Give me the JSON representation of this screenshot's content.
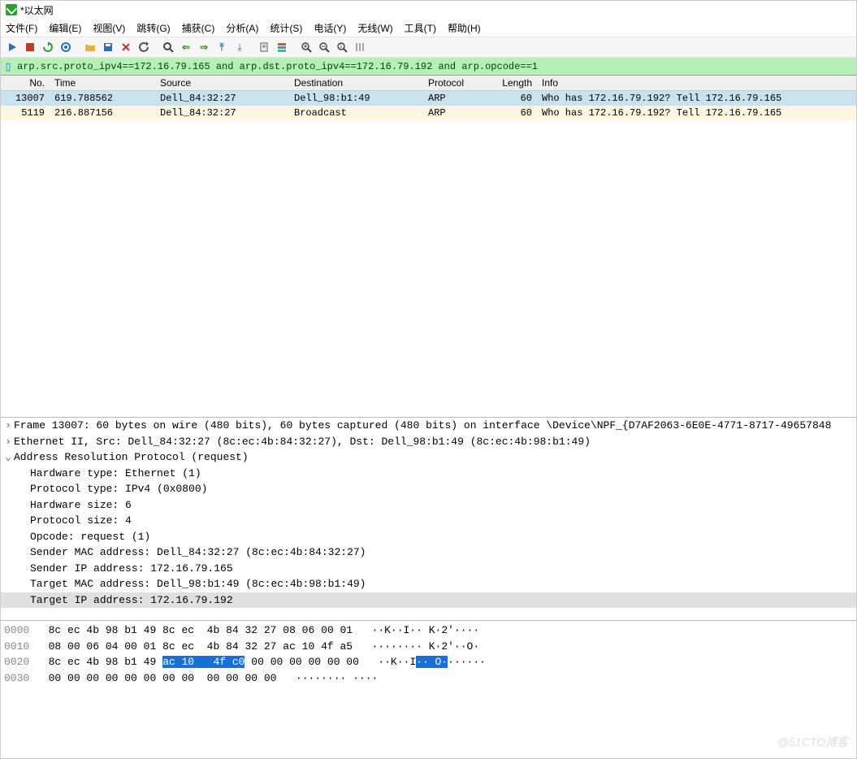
{
  "title": "*以太网",
  "menu": {
    "file": "文件(F)",
    "edit": "编辑(E)",
    "view": "视图(V)",
    "go": "跳转(G)",
    "capture": "捕获(C)",
    "analyze": "分析(A)",
    "stats": "统计(S)",
    "telephony": "电话(Y)",
    "wireless": "无线(W)",
    "tools": "工具(T)",
    "help": "帮助(H)"
  },
  "filter": "arp.src.proto_ipv4==172.16.79.165 and arp.dst.proto_ipv4==172.16.79.192 and arp.opcode==1",
  "columns": {
    "no": "No.",
    "time": "Time",
    "source": "Source",
    "destination": "Destination",
    "protocol": "Protocol",
    "length": "Length",
    "info": "Info"
  },
  "packets": [
    {
      "no": "13007",
      "time": "619.788562",
      "src": "Dell_84:32:27",
      "dst": "Dell_98:b1:49",
      "proto": "ARP",
      "len": "60",
      "info": "Who has 172.16.79.192? Tell 172.16.79.165",
      "selected": true
    },
    {
      "no": "5119",
      "time": "216.887156",
      "src": "Dell_84:32:27",
      "dst": "Broadcast",
      "proto": "ARP",
      "len": "60",
      "info": "Who has 172.16.79.192? Tell 172.16.79.165",
      "selected": false
    }
  ],
  "details": {
    "frame": "Frame 13007: 60 bytes on wire (480 bits), 60 bytes captured (480 bits) on interface \\Device\\NPF_{D7AF2063-6E0E-4771-8717-49657848",
    "eth": "Ethernet II, Src: Dell_84:32:27 (8c:ec:4b:84:32:27), Dst: Dell_98:b1:49 (8c:ec:4b:98:b1:49)",
    "arp": "Address Resolution Protocol (request)",
    "arp_fields": [
      "Hardware type: Ethernet (1)",
      "Protocol type: IPv4 (0x0800)",
      "Hardware size: 6",
      "Protocol size: 4",
      "Opcode: request (1)",
      "Sender MAC address: Dell_84:32:27 (8c:ec:4b:84:32:27)",
      "Sender IP address: 172.16.79.165",
      "Target MAC address: Dell_98:b1:49 (8c:ec:4b:98:b1:49)",
      "Target IP address: 172.16.79.192"
    ]
  },
  "hex": {
    "rows": [
      {
        "off": "0000",
        "b1": "8c ec 4b 98 b1 49 8c ec",
        "b2": "  4b 84 32 27 08 06 00 01",
        "a": "   ··K··I·· K·2'····"
      },
      {
        "off": "0010",
        "b1": "08 00 06 04 00 01 8c ec",
        "b2": "  4b 84 32 27 ac 10 4f a5",
        "a": "   ········ K·2'··O·"
      },
      {
        "off": "0020",
        "b1": "8c ec 4b 98 b1 49 ",
        "sel": "ac 10   4f c0",
        "b2": " 00 00 00 00 00 00",
        "a_pre": "   ··K··I",
        "a_sel": "·· O·",
        "a_post": "······"
      },
      {
        "off": "0030",
        "b1": "00 00 00 00 00 00 00 00",
        "b2": "  00 00 00 00",
        "a": "   ········ ····"
      }
    ]
  },
  "watermark": "@51CTO博客"
}
